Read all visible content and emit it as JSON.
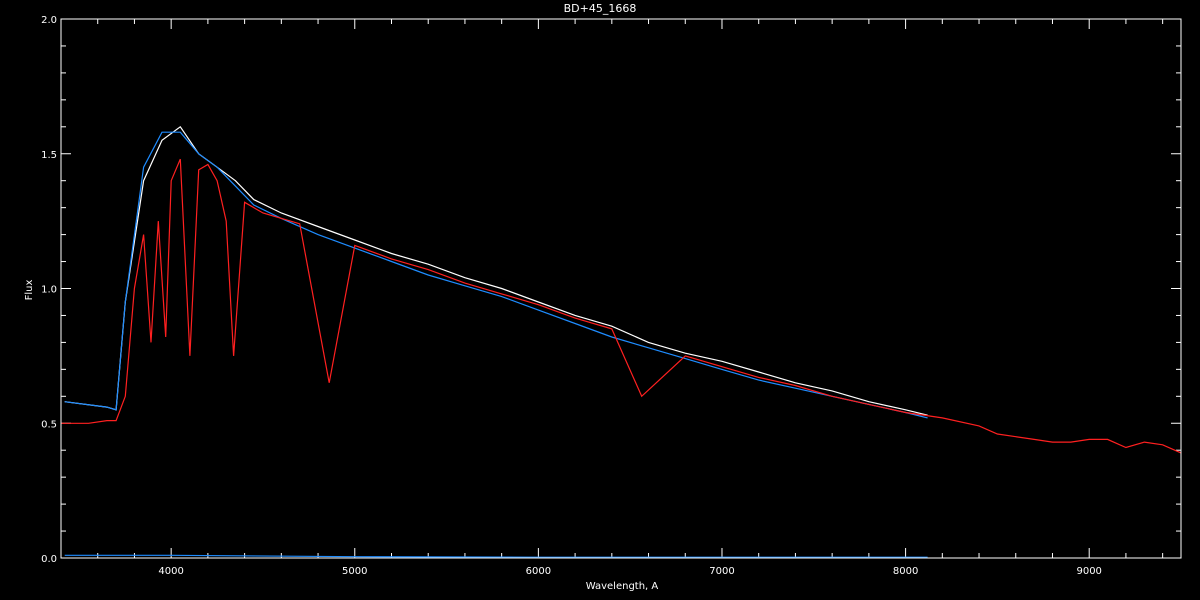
{
  "chart_data": {
    "type": "line",
    "title": "BD+45_1668",
    "xlabel": "Wavelength, A",
    "ylabel": "Flux",
    "xlim": [
      3400,
      9500
    ],
    "ylim": [
      0.0,
      2.0
    ],
    "xticks": [
      4000,
      5000,
      6000,
      7000,
      8000,
      9000
    ],
    "xtick_labels": [
      "4000",
      "5000",
      "6000",
      "7000",
      "8000",
      "9000"
    ],
    "yticks": [
      0.0,
      0.5,
      1.0,
      1.5,
      2.0
    ],
    "ytick_labels": [
      "0.0",
      "0.5",
      "1.0",
      "1.5",
      "2.0"
    ],
    "grid": false,
    "background": "#000000",
    "axis_color": "#ffffff",
    "series": [
      {
        "color": "#ffffff",
        "x": [
          3420,
          3650,
          3700,
          3750,
          3850,
          3950,
          4050,
          4150,
          4250,
          4350,
          4450,
          4600,
          4800,
          5000,
          5200,
          5400,
          5600,
          5800,
          6000,
          6200,
          6400,
          6600,
          6800,
          7000,
          7200,
          7400,
          7600,
          7800,
          8000,
          8120
        ],
        "y": [
          0.58,
          0.56,
          0.55,
          0.95,
          1.4,
          1.55,
          1.6,
          1.5,
          1.45,
          1.4,
          1.33,
          1.28,
          1.23,
          1.18,
          1.13,
          1.09,
          1.04,
          1.0,
          0.95,
          0.9,
          0.86,
          0.8,
          0.76,
          0.73,
          0.69,
          0.65,
          0.62,
          0.58,
          0.55,
          0.53
        ]
      },
      {
        "color": "#1e8cff",
        "x": [
          3420,
          3650,
          3700,
          3750,
          3850,
          3950,
          4050,
          4150,
          4250,
          4350,
          4450,
          4600,
          4800,
          5000,
          5200,
          5400,
          5600,
          5800,
          6000,
          6200,
          6400,
          6600,
          6800,
          7000,
          7200,
          7400,
          7600,
          7800,
          8000,
          8120
        ],
        "y": [
          0.58,
          0.56,
          0.55,
          0.95,
          1.45,
          1.58,
          1.58,
          1.5,
          1.45,
          1.38,
          1.31,
          1.26,
          1.2,
          1.15,
          1.1,
          1.05,
          1.01,
          0.97,
          0.92,
          0.87,
          0.82,
          0.78,
          0.74,
          0.7,
          0.66,
          0.63,
          0.6,
          0.57,
          0.54,
          0.52
        ]
      },
      {
        "color": "#ff2020",
        "x": [
          3400,
          3550,
          3650,
          3700,
          3750,
          3800,
          3850,
          3890,
          3930,
          3970,
          4000,
          4050,
          4102,
          4150,
          4200,
          4250,
          4300,
          4340,
          4400,
          4500,
          4700,
          4861,
          5000,
          5200,
          5400,
          5600,
          5800,
          6000,
          6200,
          6400,
          6563,
          6800,
          7000,
          7200,
          7400,
          7600,
          7800,
          8000,
          8200,
          8400,
          8500,
          8600,
          8700,
          8800,
          8900,
          9000,
          9100,
          9200,
          9300,
          9400,
          9500
        ],
        "y": [
          0.5,
          0.5,
          0.51,
          0.51,
          0.6,
          1.0,
          1.2,
          0.8,
          1.25,
          0.82,
          1.4,
          1.48,
          0.75,
          1.44,
          1.46,
          1.4,
          1.25,
          0.75,
          1.32,
          1.28,
          1.24,
          0.65,
          1.16,
          1.11,
          1.07,
          1.02,
          0.98,
          0.94,
          0.89,
          0.85,
          0.6,
          0.75,
          0.71,
          0.67,
          0.64,
          0.6,
          0.57,
          0.54,
          0.52,
          0.49,
          0.46,
          0.45,
          0.44,
          0.43,
          0.43,
          0.44,
          0.44,
          0.41,
          0.43,
          0.42,
          0.39
        ]
      },
      {
        "color": "#1e8cff",
        "x": [
          3420,
          4000,
          5000,
          6000,
          7000,
          8120
        ],
        "y": [
          0.01,
          0.01,
          0.005,
          0.003,
          0.003,
          0.003
        ]
      }
    ]
  }
}
